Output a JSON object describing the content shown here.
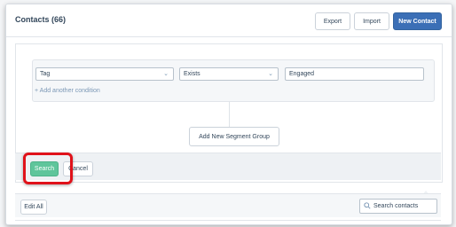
{
  "header": {
    "title": "Contacts (66)",
    "export_label": "Export",
    "import_label": "Import",
    "new_contact_label": "New Contact"
  },
  "segment": {
    "conditions": [
      {
        "field": "Tag",
        "operator": "Exists",
        "value": "Engaged"
      }
    ],
    "add_condition_label": "+ Add another condition",
    "add_group_label": "Add New Segment Group"
  },
  "actions": {
    "search_label": "Search",
    "cancel_label": "Cancel"
  },
  "toolbar": {
    "edit_all_label": "Edit All",
    "search_placeholder": "Search contacts"
  },
  "colors": {
    "primary": "#3b6fb6",
    "search_green": "#5fc59b",
    "highlight_red": "#e0121a"
  }
}
